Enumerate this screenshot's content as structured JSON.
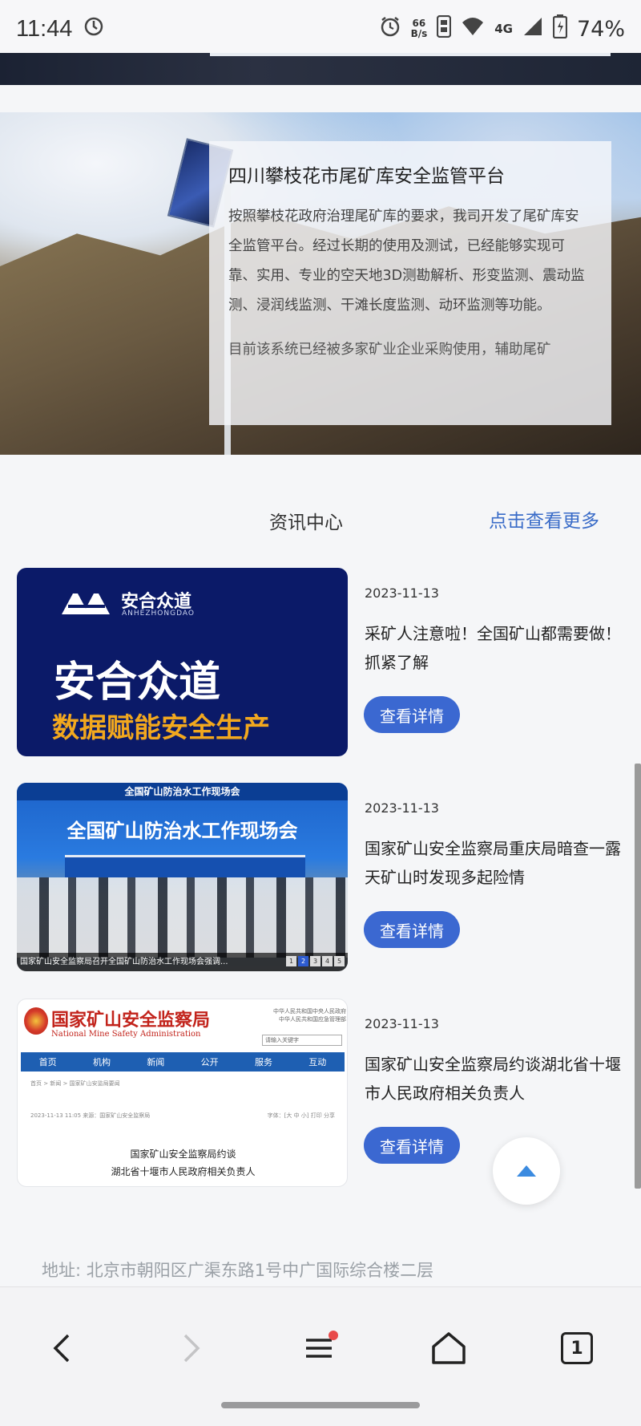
{
  "status_bar": {
    "time": "11:44",
    "net_speed_value": "66",
    "net_speed_unit": "B/s",
    "network": "4G",
    "battery": "74%"
  },
  "hero": {
    "title": "四川攀枝花市尾矿库安全监管平台",
    "body": "按照攀枝花政府治理尾矿库的要求，我司开发了尾矿库安全监管平台。经过长期的使用及测试，已经能够实现可靠、实用、专业的空天地3D测勘解析、形变监测、震动监测、浸润线监测、干滩长度监测、动环监测等功能。",
    "body_more": "目前该系统已经被多家矿业企业采购使用，辅助尾矿"
  },
  "news": {
    "section_title": "资讯中心",
    "more_link": "点击查看更多",
    "items": [
      {
        "date": "2023-11-13",
        "headline": "采矿人注意啦！全国矿山都需要做！抓紧了解",
        "button": "查看详情",
        "thumb": {
          "logo_text": "安合众道",
          "logo_sub": "ANHEZHONGDAO",
          "big_text": "安合众道",
          "slogan": "数据赋能安全生产"
        }
      },
      {
        "date": "2023-11-13",
        "headline": "国家矿山安全监察局重庆局暗查一露天矿山时发现多起险情",
        "button": "查看详情",
        "thumb": {
          "banner_top": "全国矿山防治水工作现场会",
          "banner": "全国矿山防治水工作现场会",
          "caption": "国家矿山安全监察局召开全国矿山防治水工作现场会强调...",
          "pager": [
            "1",
            "2",
            "3",
            "4",
            "5"
          ]
        }
      },
      {
        "date": "2023-11-13",
        "headline": "国家矿山安全监察局约谈湖北省十堰市人民政府相关负责人",
        "button": "查看详情",
        "thumb": {
          "site_title": "国家矿山安全监察局",
          "site_en": "National Mine Safety Administration",
          "top_right_1": "中华人民共和国中央人民政府",
          "top_right_2": "中华人民共和国应急管理部",
          "search_placeholder": "请输入关键字",
          "nav": [
            "首页",
            "机构",
            "新闻",
            "公开",
            "服务",
            "互动"
          ],
          "crumb": "首页 > 新闻 > 国家矿山安监局要闻",
          "meta_left": "2023-11-13 11:05 来源：国家矿山安全监察局",
          "meta_right": "字体：[大 中 小]  打印  分享",
          "doc_line1": "国家矿山安全监察局约谈",
          "doc_line2": "湖北省十堰市人民政府相关负责人"
        }
      }
    ]
  },
  "footer": {
    "address": "地址: 北京市朝阳区广渠东路1号中广国际综合楼二层"
  },
  "bottom_nav": {
    "tab_count": "1"
  }
}
